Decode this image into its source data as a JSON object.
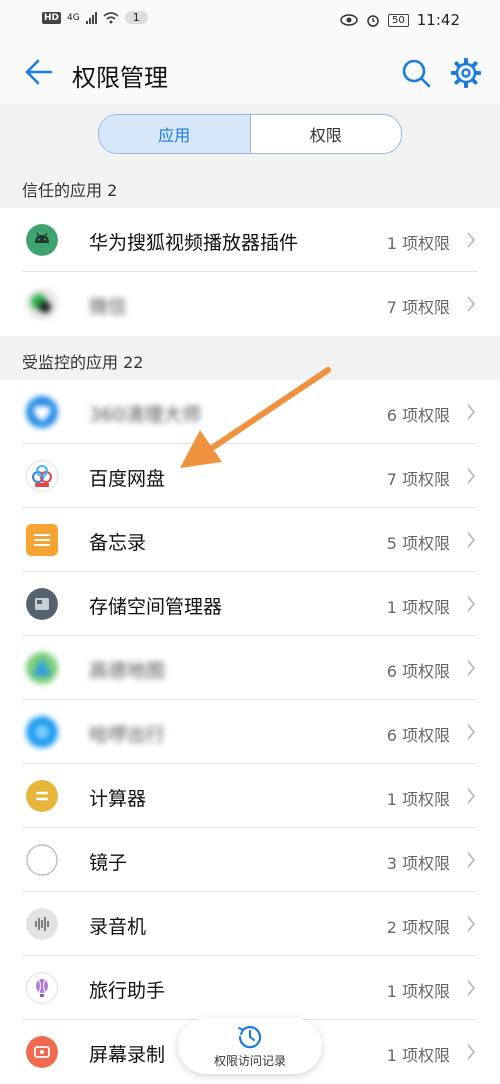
{
  "status_bar": {
    "network": "4G",
    "notifications": "1",
    "battery": "50",
    "time": "11:42"
  },
  "header": {
    "title": "权限管理"
  },
  "segment": {
    "tab_apps": "应用",
    "tab_permissions": "权限"
  },
  "trusted": {
    "header": "信任的应用 2",
    "items": [
      {
        "name": "华为搜狐视频播放器插件",
        "count": "1 项权限"
      },
      {
        "name": "微信",
        "count": "7 项权限"
      }
    ]
  },
  "monitored": {
    "header": "受监控的应用 22",
    "items": [
      {
        "name": "360清理大师",
        "count": "6 项权限"
      },
      {
        "name": "百度网盘",
        "count": "7 项权限"
      },
      {
        "name": "备忘录",
        "count": "5 项权限"
      },
      {
        "name": "存储空间管理器",
        "count": "1 项权限"
      },
      {
        "name": "高德地图",
        "count": "6 项权限"
      },
      {
        "name": "哈啰出行",
        "count": "6 项权限"
      },
      {
        "name": "计算器",
        "count": "1 项权限"
      },
      {
        "name": "镜子",
        "count": "3 项权限"
      },
      {
        "name": "录音机",
        "count": "2 项权限"
      },
      {
        "name": "旅行助手",
        "count": "1 项权限"
      },
      {
        "name": "屏幕录制",
        "count": "1 项权限"
      }
    ]
  },
  "bottom": {
    "label": "权限访问记录"
  },
  "colors": {
    "accent": "#1a7ce0",
    "annotation_arrow": "#f0913f"
  }
}
